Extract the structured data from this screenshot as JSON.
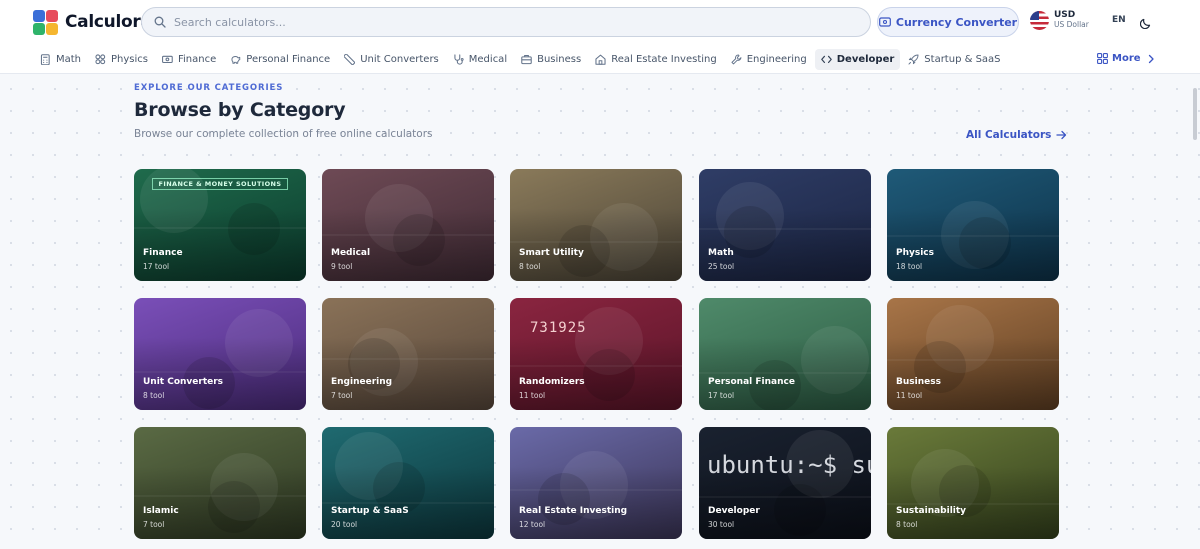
{
  "header": {
    "logo_text": "Calculora",
    "search_placeholder": "Search calculators...",
    "currency_button": "Currency Converter",
    "currency_code": "USD",
    "currency_name": "US Dollar",
    "language": "EN"
  },
  "nav": {
    "items": [
      {
        "label": "Math",
        "icon": "calculator-icon"
      },
      {
        "label": "Physics",
        "icon": "atom-icon"
      },
      {
        "label": "Finance",
        "icon": "banknote-icon"
      },
      {
        "label": "Personal Finance",
        "icon": "piggy-bank-icon"
      },
      {
        "label": "Unit Converters",
        "icon": "ruler-icon"
      },
      {
        "label": "Medical",
        "icon": "stethoscope-icon"
      },
      {
        "label": "Business",
        "icon": "briefcase-icon"
      },
      {
        "label": "Real Estate Investing",
        "icon": "house-icon"
      },
      {
        "label": "Engineering",
        "icon": "wrench-icon"
      },
      {
        "label": "Developer",
        "icon": "code-icon"
      },
      {
        "label": "Startup & SaaS",
        "icon": "rocket-icon"
      }
    ],
    "active": "Developer",
    "more_label": "More"
  },
  "section": {
    "eyebrow": "EXPLORE OUR CATEGORIES",
    "title": "Browse by Category",
    "subtitle": "Browse our complete collection of free online calculators",
    "all_link": "All Calculators"
  },
  "categories": [
    {
      "name": "Finance",
      "count": "17 tool",
      "banner": "FINANCE & MONEY SOLUTIONS",
      "color_top": "#1f6b4c",
      "color_bottom": "#0b3a2c"
    },
    {
      "name": "Medical",
      "count": "9 tool",
      "color_top": "#6e4a55",
      "color_bottom": "#3f2a34"
    },
    {
      "name": "Smart Utility",
      "count": "8 tool",
      "color_top": "#8a7a5a",
      "color_bottom": "#4a4336"
    },
    {
      "name": "Math",
      "count": "25 tool",
      "color_top": "#2f3d66",
      "color_bottom": "#1a2442"
    },
    {
      "name": "Physics",
      "count": "18 tool",
      "color_top": "#1f5a78",
      "color_bottom": "#0d3148"
    },
    {
      "name": "Unit Converters",
      "count": "8 tool",
      "color_top": "#7a4fb8",
      "color_bottom": "#4a2b7a"
    },
    {
      "name": "Engineering",
      "count": "7 tool",
      "color_top": "#8a7258",
      "color_bottom": "#56463a"
    },
    {
      "name": "Randomizers",
      "count": "11 tool",
      "digits": "731925",
      "color_top": "#8a2540",
      "color_bottom": "#5a1428"
    },
    {
      "name": "Personal Finance",
      "count": "17 tool",
      "color_top": "#4f8a6a",
      "color_bottom": "#2b5a42"
    },
    {
      "name": "Business",
      "count": "11 tool",
      "color_top": "#a87548",
      "color_bottom": "#5e3e22"
    },
    {
      "name": "Islamic",
      "count": "7 tool",
      "color_top": "#5a6a44",
      "color_bottom": "#2e3822"
    },
    {
      "name": "Startup & SaaS",
      "count": "20 tool",
      "color_top": "#1f6a70",
      "color_bottom": "#0c363c"
    },
    {
      "name": "Real Estate Investing",
      "count": "12 tool",
      "color_top": "#6a6aa8",
      "color_bottom": "#3a3456"
    },
    {
      "name": "Developer",
      "count": "30 tool",
      "terminal": "ubuntu:~$ sudo",
      "color_top": "#1a2230",
      "color_bottom": "#0b0f18"
    },
    {
      "name": "Sustainability",
      "count": "8 tool",
      "color_top": "#6a7a3a",
      "color_bottom": "#33401c"
    }
  ]
}
